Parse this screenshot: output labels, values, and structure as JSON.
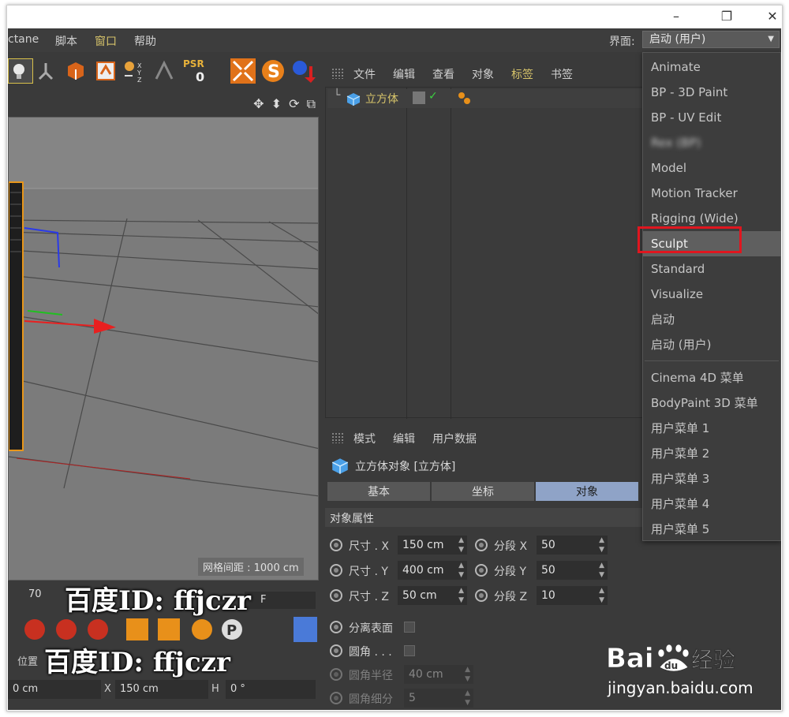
{
  "menubar": {
    "items": [
      "ctane",
      "脚本",
      "窗口",
      "帮助"
    ],
    "highlighted": "窗口",
    "layout_label": "界面:",
    "layout_value": "启动 (用户)"
  },
  "toolbar": {
    "psr_label": "PSR",
    "psr_value": "0"
  },
  "object_manager": {
    "menu": [
      "文件",
      "编辑",
      "查看",
      "对象",
      "标签",
      "书签"
    ],
    "highlighted": "标签",
    "object_name": "立方体"
  },
  "viewport": {
    "grid_spacing": "网格间距 : 1000 cm"
  },
  "timeline": {
    "frame": "70",
    "field_text": "F"
  },
  "coords": {
    "header_label": "位置",
    "x_value": "0 cm",
    "size_x_label": "X",
    "size_x_value": "150 cm",
    "h_label": "H",
    "h_value": "0 °"
  },
  "attribute_manager": {
    "menu": [
      "模式",
      "编辑",
      "用户数据"
    ],
    "title": "立方体对象 [立方体]",
    "tabs": [
      "基本",
      "坐标",
      "对象"
    ],
    "active_tab": "对象",
    "section": "对象属性",
    "size_rows": [
      {
        "label": "尺寸 . X",
        "value": "150 cm",
        "seg_label": "分段 X",
        "seg_value": "50"
      },
      {
        "label": "尺寸 . Y",
        "value": "400 cm",
        "seg_label": "分段 Y",
        "seg_value": "50"
      },
      {
        "label": "尺寸 . Z",
        "value": "50 cm",
        "seg_label": "分段 Z",
        "seg_value": "10"
      }
    ],
    "separate_surfaces": "分离表面",
    "fillet": "圆角 . . .",
    "fillet_radius_label": "圆角半径",
    "fillet_radius_value": "40 cm",
    "fillet_subdiv_label": "圆角细分",
    "fillet_subdiv_value": "5"
  },
  "layout_dropdown": {
    "items": [
      "Animate",
      "BP - 3D Paint",
      "BP - UV Edit",
      "Rex (BP)",
      "Model",
      "Motion Tracker",
      "Rigging (Wide)",
      "Sculpt",
      "Standard",
      "Visualize",
      "启动",
      "启动 (用户)"
    ],
    "menu_items": [
      "Cinema 4D 菜单",
      "BodyPaint 3D 菜单",
      "用户菜单 1",
      "用户菜单 2",
      "用户菜单 3",
      "用户菜单 4",
      "用户菜单 5"
    ],
    "hovered": "Sculpt"
  },
  "watermark": {
    "text1": "百度ID: ffjczr",
    "text2": "百度ID: ffjczr",
    "logo": "Baidu经验",
    "url": "jingyan.baidu.com"
  }
}
